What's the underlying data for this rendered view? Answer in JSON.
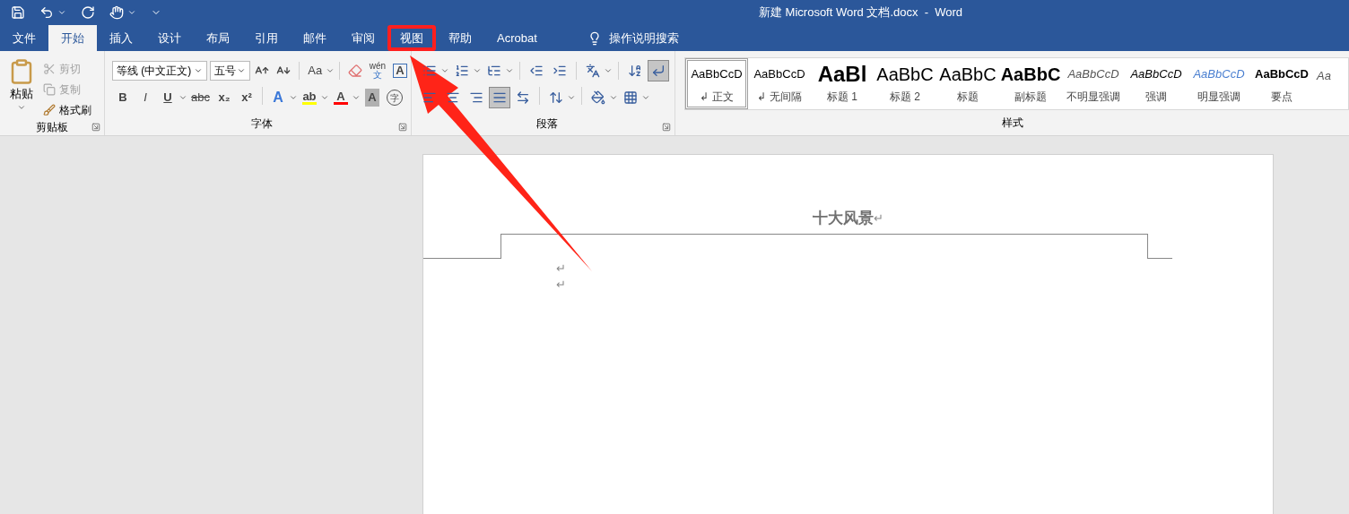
{
  "title": "新建 Microsoft Word 文档.docx  -  Word",
  "tabs": [
    {
      "label": "文件",
      "selected": false,
      "highlighted": false
    },
    {
      "label": "开始",
      "selected": true,
      "highlighted": false
    },
    {
      "label": "插入",
      "selected": false,
      "highlighted": false
    },
    {
      "label": "设计",
      "selected": false,
      "highlighted": false
    },
    {
      "label": "布局",
      "selected": false,
      "highlighted": false
    },
    {
      "label": "引用",
      "selected": false,
      "highlighted": false
    },
    {
      "label": "邮件",
      "selected": false,
      "highlighted": false
    },
    {
      "label": "审阅",
      "selected": false,
      "highlighted": false
    },
    {
      "label": "视图",
      "selected": false,
      "highlighted": true
    },
    {
      "label": "帮助",
      "selected": false,
      "highlighted": false
    },
    {
      "label": "Acrobat",
      "selected": false,
      "highlighted": false
    }
  ],
  "tell_me": {
    "placeholder": "操作说明搜索"
  },
  "clipboard": {
    "label": "剪贴板",
    "paste": "粘贴",
    "items": [
      {
        "kind": "cut",
        "label": "剪切",
        "disabled": true
      },
      {
        "kind": "copy",
        "label": "复制",
        "disabled": true
      },
      {
        "kind": "painter",
        "label": "格式刷",
        "disabled": false
      }
    ]
  },
  "font": {
    "label": "字体",
    "name": "等线 (中文正文)",
    "size": "五号",
    "row1": [
      {
        "kind": "grow",
        "dropdown": false
      },
      {
        "kind": "shrink",
        "dropdown": false
      },
      {
        "kind": "sep"
      },
      {
        "kind": "case",
        "label": "Aa",
        "dropdown": true
      },
      {
        "kind": "sep"
      },
      {
        "kind": "eraser",
        "dropdown": false
      },
      {
        "kind": "phonetic",
        "label": "wén",
        "sub": "文",
        "dropdown": false
      },
      {
        "kind": "boxed",
        "label": "A",
        "dropdown": false
      }
    ],
    "row2": [
      {
        "kind": "bold",
        "label": "B",
        "dropdown": false
      },
      {
        "kind": "italic",
        "label": "I",
        "dropdown": false
      },
      {
        "kind": "underline",
        "label": "U",
        "dropdown": true
      },
      {
        "kind": "strike",
        "label": "abc",
        "dropdown": false
      },
      {
        "kind": "subscript",
        "label": "x₂",
        "dropdown": false
      },
      {
        "kind": "superscript",
        "label": "x²",
        "dropdown": false
      },
      {
        "kind": "sep"
      },
      {
        "kind": "effects",
        "label": "A",
        "dropdown": true
      },
      {
        "kind": "highlight",
        "label": "ab",
        "color": "#ffff00",
        "dropdown": true
      },
      {
        "kind": "fontcolor",
        "label": "A",
        "color": "#ff0000",
        "dropdown": true
      },
      {
        "kind": "shaded",
        "label": "A",
        "dropdown": false
      },
      {
        "kind": "circled",
        "label": "字",
        "dropdown": false
      }
    ]
  },
  "paragraph": {
    "label": "段落",
    "row1": [
      {
        "kind": "bullets",
        "dropdown": true,
        "selected": false
      },
      {
        "kind": "numbering",
        "dropdown": true,
        "selected": false
      },
      {
        "kind": "multilevel",
        "dropdown": true,
        "selected": false
      },
      {
        "kind": "sep"
      },
      {
        "kind": "outdent",
        "dropdown": false,
        "selected": false
      },
      {
        "kind": "indent",
        "dropdown": false,
        "selected": false
      },
      {
        "kind": "sep"
      },
      {
        "kind": "layout",
        "dropdown": true,
        "selected": false
      },
      {
        "kind": "sep"
      },
      {
        "kind": "sort",
        "dropdown": false,
        "selected": false
      },
      {
        "kind": "marks",
        "dropdown": false,
        "selected": true
      }
    ],
    "row2": [
      {
        "kind": "left",
        "dropdown": false,
        "selected": false
      },
      {
        "kind": "center",
        "dropdown": false,
        "selected": false
      },
      {
        "kind": "right",
        "dropdown": false,
        "selected": false
      },
      {
        "kind": "justify",
        "dropdown": false,
        "selected": true
      },
      {
        "kind": "distributed",
        "dropdown": false,
        "selected": false
      },
      {
        "kind": "sep"
      },
      {
        "kind": "spacing",
        "dropdown": true,
        "selected": false
      },
      {
        "kind": "sep"
      },
      {
        "kind": "shading",
        "dropdown": true,
        "selected": false
      },
      {
        "kind": "borders",
        "dropdown": true,
        "selected": false
      }
    ]
  },
  "styles": {
    "label": "样式",
    "items": [
      {
        "preview": "AaBbCcD",
        "name": "↲ 正文",
        "kind": "normal",
        "selected": true
      },
      {
        "preview": "AaBbCcD",
        "name": "↲ 无间隔",
        "kind": "normal",
        "selected": false
      },
      {
        "preview": "AaBl",
        "name": "标题 1",
        "kind": "h1",
        "selected": false
      },
      {
        "preview": "AaBbC",
        "name": "标题 2",
        "kind": "h2",
        "selected": false
      },
      {
        "preview": "AaBbC",
        "name": "标题",
        "kind": "title",
        "selected": false
      },
      {
        "preview": "AaBbC",
        "name": "副标题",
        "kind": "subtitle",
        "selected": false
      },
      {
        "preview": "AaBbCcD",
        "name": "不明显强调",
        "kind": "subtle",
        "selected": false
      },
      {
        "preview": "AaBbCcD",
        "name": "强调",
        "kind": "emphasis",
        "selected": false
      },
      {
        "preview": "AaBbCcD",
        "name": "明显强调",
        "kind": "intense",
        "selected": false
      },
      {
        "preview": "AaBbCcD",
        "name": "要点",
        "kind": "strong",
        "selected": false
      },
      {
        "preview": "Aa",
        "kind": "subtle",
        "selected": false
      }
    ]
  },
  "document": {
    "header": {
      "text": "十大风景",
      "mark": "↵"
    },
    "paragraphs": [
      {
        "mark": "↵"
      },
      {
        "mark": "↵"
      }
    ]
  }
}
